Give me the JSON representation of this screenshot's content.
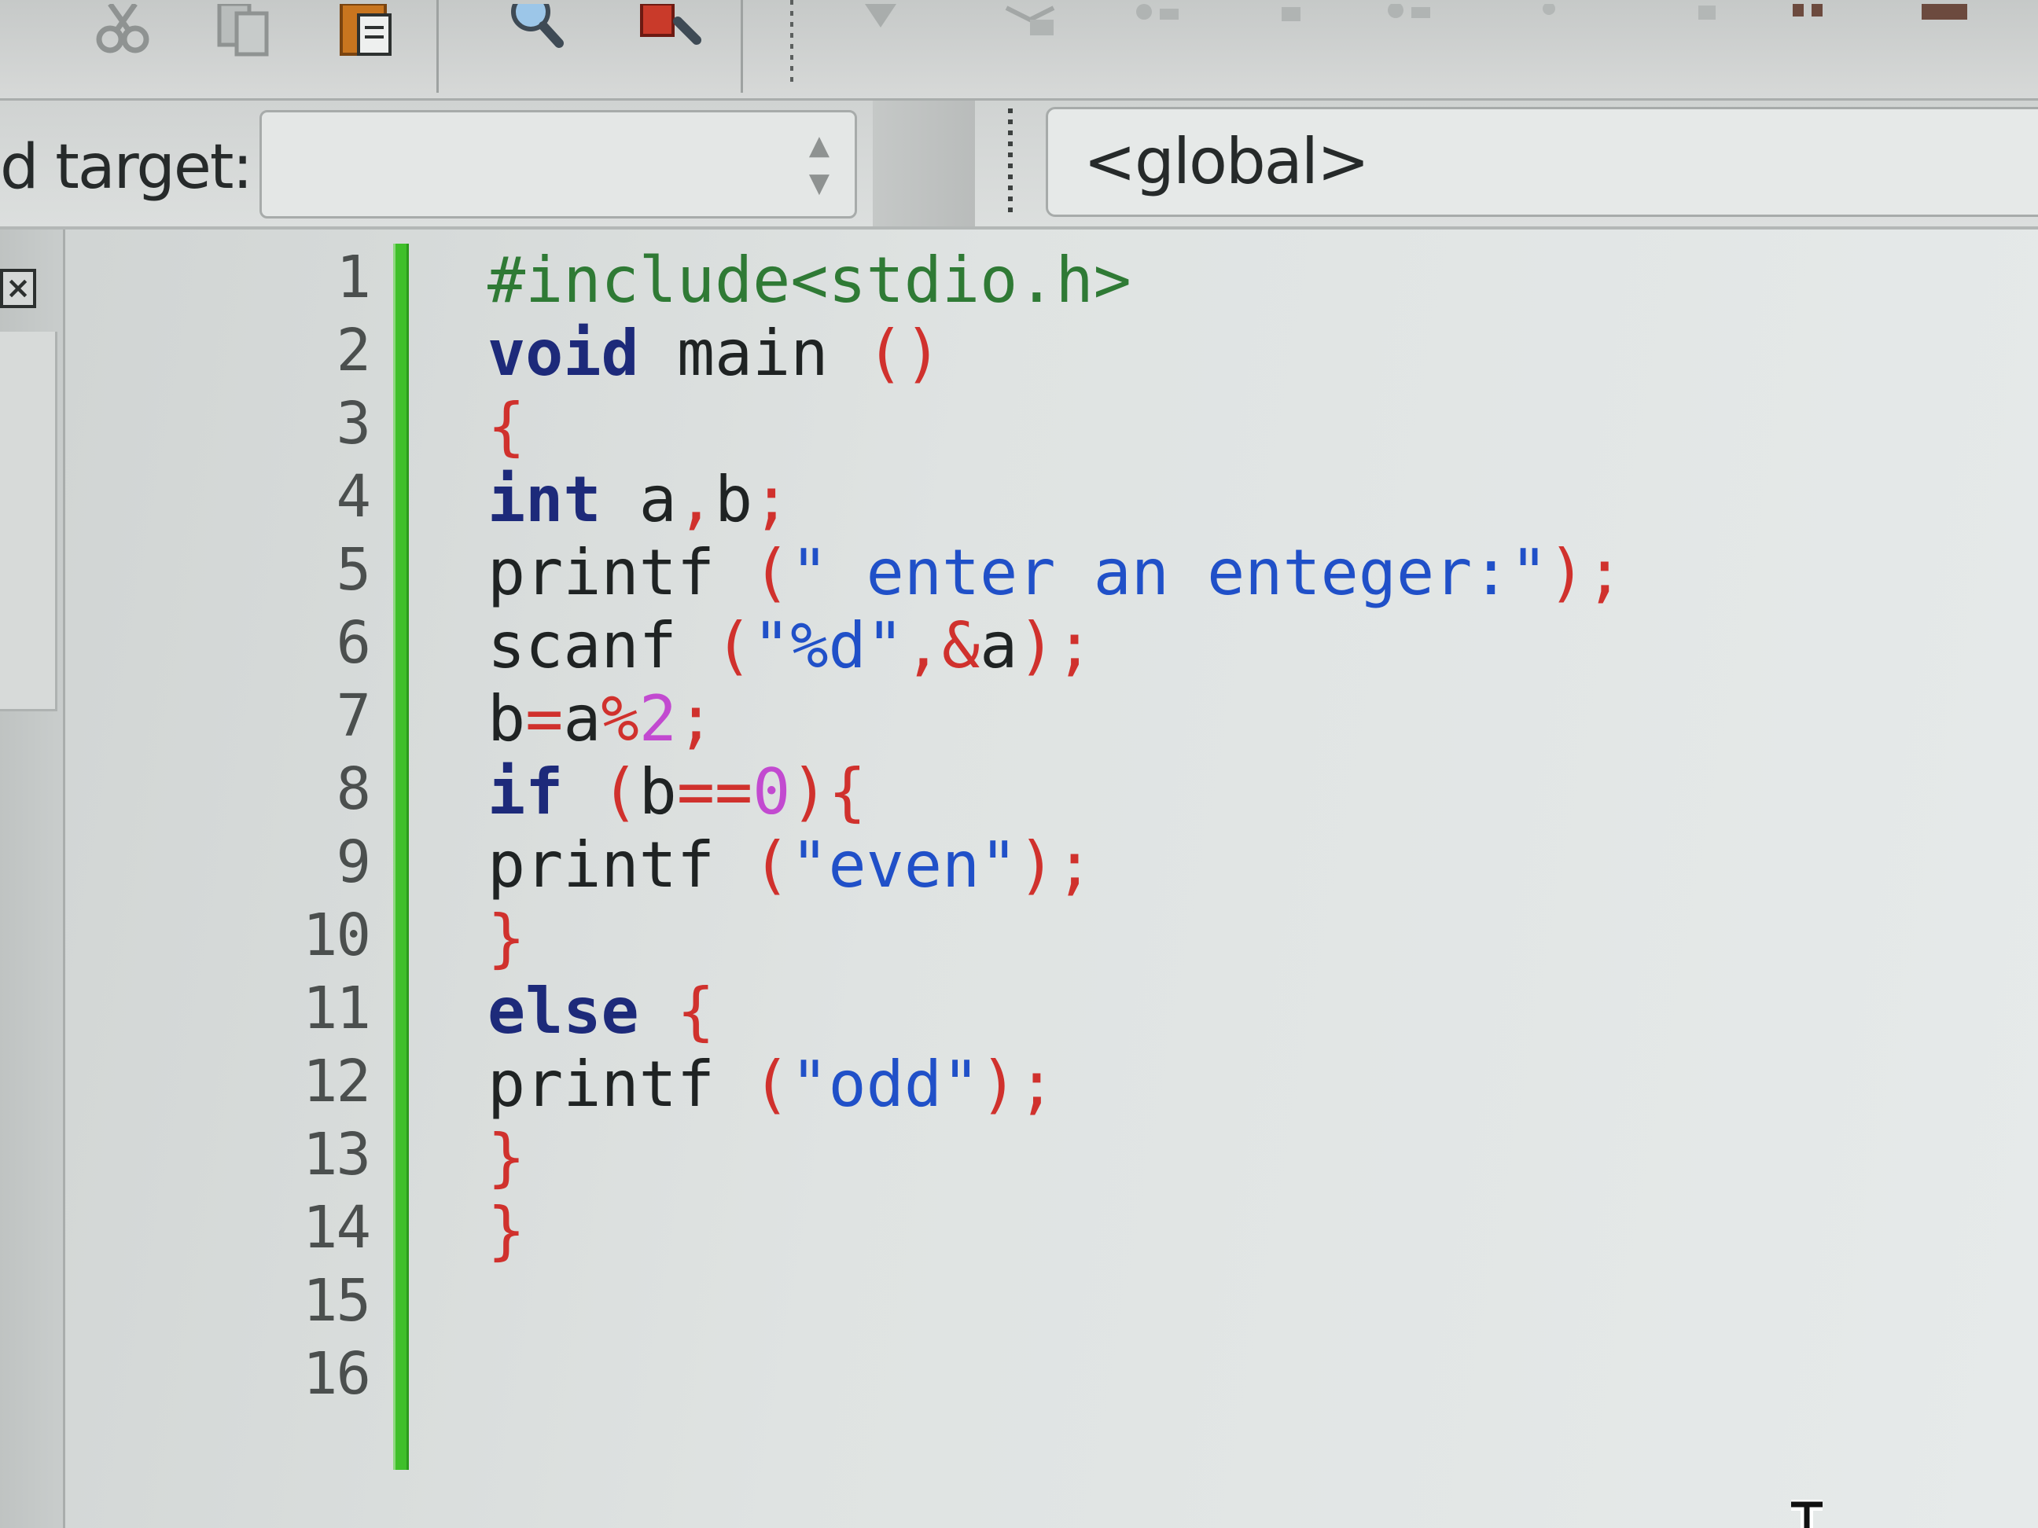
{
  "toolbar": {
    "icons": [
      "cut-icon",
      "copy-icon",
      "paste-icon",
      "find-icon",
      "find-replace-icon",
      "build-icon",
      "run-icon",
      "debug-icon",
      "breakpoint-icon",
      "step-icon",
      "stop-icon"
    ]
  },
  "target_bar": {
    "label": "d target:",
    "build_target_value": "",
    "scope_value": "<global>"
  },
  "editor": {
    "line_numbers": [
      "1",
      "2",
      "3",
      "4",
      "5",
      "6",
      "7",
      "8",
      "9",
      "10",
      "11",
      "12",
      "13",
      "14",
      "15",
      "16"
    ],
    "lines": [
      [
        {
          "t": "#include<stdio.h>",
          "c": "pp"
        }
      ],
      [
        {
          "t": "void",
          "c": "kw"
        },
        {
          "t": " main ",
          "c": "id"
        },
        {
          "t": "()",
          "c": "pun"
        }
      ],
      [
        {
          "t": "{",
          "c": "pun"
        }
      ],
      [
        {
          "t": "int",
          "c": "kw"
        },
        {
          "t": " a",
          "c": "id"
        },
        {
          "t": ",",
          "c": "pun"
        },
        {
          "t": "b",
          "c": "id"
        },
        {
          "t": ";",
          "c": "pun"
        }
      ],
      [
        {
          "t": "printf ",
          "c": "id"
        },
        {
          "t": "(",
          "c": "pun"
        },
        {
          "t": "\" enter an enteger:\"",
          "c": "str"
        },
        {
          "t": ");",
          "c": "pun"
        }
      ],
      [
        {
          "t": "scanf ",
          "c": "id"
        },
        {
          "t": "(",
          "c": "pun"
        },
        {
          "t": "\"%d\"",
          "c": "str"
        },
        {
          "t": ",&",
          "c": "pun"
        },
        {
          "t": "a",
          "c": "id"
        },
        {
          "t": ");",
          "c": "pun"
        }
      ],
      [
        {
          "t": "b",
          "c": "id"
        },
        {
          "t": "=",
          "c": "pun"
        },
        {
          "t": "a",
          "c": "id"
        },
        {
          "t": "%",
          "c": "pun"
        },
        {
          "t": "2",
          "c": "num"
        },
        {
          "t": ";",
          "c": "pun"
        }
      ],
      [
        {
          "t": "if",
          "c": "kw"
        },
        {
          "t": " (",
          "c": "pun"
        },
        {
          "t": "b",
          "c": "id"
        },
        {
          "t": "==",
          "c": "pun"
        },
        {
          "t": "0",
          "c": "num"
        },
        {
          "t": "){",
          "c": "pun"
        }
      ],
      [
        {
          "t": "printf ",
          "c": "id"
        },
        {
          "t": "(",
          "c": "pun"
        },
        {
          "t": "\"even\"",
          "c": "str"
        },
        {
          "t": ");",
          "c": "pun"
        }
      ],
      [
        {
          "t": "}",
          "c": "pun"
        }
      ],
      [
        {
          "t": "else",
          "c": "kw"
        },
        {
          "t": " {",
          "c": "pun"
        }
      ],
      [
        {
          "t": "printf ",
          "c": "id"
        },
        {
          "t": "(",
          "c": "pun"
        },
        {
          "t": "\"odd\"",
          "c": "str"
        },
        {
          "t": ");",
          "c": "pun"
        }
      ],
      [
        {
          "t": "}",
          "c": "pun"
        }
      ],
      [
        {
          "t": "}",
          "c": "pun"
        }
      ],
      [],
      []
    ]
  },
  "colors": {
    "keyword": "#1d2a7a",
    "preprocessor": "#2f7a35",
    "string": "#2050c8",
    "punctuation": "#d0312d",
    "number": "#c24ad0",
    "fold_marker": "#3fbf2a"
  }
}
